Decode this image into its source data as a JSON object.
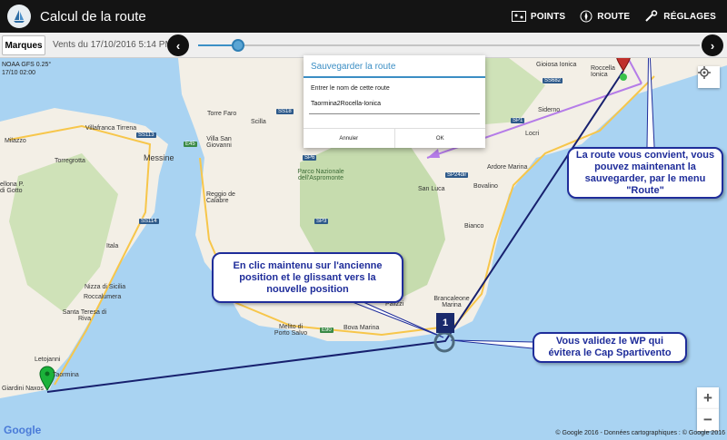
{
  "app": {
    "title": "Calcul de la route"
  },
  "toolbar": {
    "points_label": "POINTS",
    "route_label": "ROUTE",
    "settings_label": "RÉGLAGES"
  },
  "timebar": {
    "tab_label": "Marques",
    "time_label": "Vents du 17/10/2016 5:14 PM",
    "prev_label": "‹",
    "next_label": "›",
    "slider_position": 0.08
  },
  "map": {
    "overlay_line1": "NOAA GFS 0.25°",
    "overlay_line2": "17/10 02:00",
    "labels": [
      {
        "id": "milazzo",
        "text": "Milazzo"
      },
      {
        "id": "villafranca",
        "text": "Villafranca Tirrena"
      },
      {
        "id": "torregrotta",
        "text": "Torregrotta"
      },
      {
        "id": "messina",
        "text": "Messine"
      },
      {
        "id": "torre-faro",
        "text": "Torre Faro"
      },
      {
        "id": "scilla",
        "text": "Scilla"
      },
      {
        "id": "villa-san-giovanni",
        "text": "Villa San Giovanni"
      },
      {
        "id": "parco",
        "text": "Parco Nazionale dell'Aspromonte"
      },
      {
        "id": "reggio",
        "text": "Reggio de Calabre"
      },
      {
        "id": "barcellona",
        "text": "ellona P. di Gotto"
      },
      {
        "id": "gioiosa",
        "text": "Gioiosa Ionica"
      },
      {
        "id": "roccella",
        "text": "Roccella Ionica"
      },
      {
        "id": "siderno",
        "text": "Siderno"
      },
      {
        "id": "locri",
        "text": "Locri"
      },
      {
        "id": "ardore",
        "text": "Ardore Marina"
      },
      {
        "id": "san-luca",
        "text": "San Luca"
      },
      {
        "id": "bovalino",
        "text": "Bovalino"
      },
      {
        "id": "bianco",
        "text": "Bianco"
      },
      {
        "id": "itala",
        "text": "Itala"
      },
      {
        "id": "nizza",
        "text": "Nizza di Sicilia"
      },
      {
        "id": "roccalumera",
        "text": "Roccalumera"
      },
      {
        "id": "santa-teresa",
        "text": "Santa Teresa di Riva"
      },
      {
        "id": "letojanni",
        "text": "Letojanni"
      },
      {
        "id": "taormina",
        "text": "Taormina"
      },
      {
        "id": "giardini",
        "text": "Giardini Naxos"
      },
      {
        "id": "melito",
        "text": "Melito di Porto Salvo"
      },
      {
        "id": "bova",
        "text": "Bova Marina"
      },
      {
        "id": "palizzi",
        "text": "Palizzi"
      },
      {
        "id": "brancaleone",
        "text": "Brancaleone Marina"
      }
    ],
    "roads": [
      {
        "id": "ss113",
        "text": "SS113"
      },
      {
        "id": "e45",
        "text": "E45"
      },
      {
        "id": "ss18",
        "text": "SS18"
      },
      {
        "id": "sp6",
        "text": "SP6"
      },
      {
        "id": "sp3",
        "text": "SP3"
      },
      {
        "id": "ss114",
        "text": "SS114"
      },
      {
        "id": "e90",
        "text": "E90"
      },
      {
        "id": "sp1",
        "text": "SP1"
      },
      {
        "id": "ss682",
        "text": "SS682"
      },
      {
        "id": "sp24",
        "text": "SP24dir"
      }
    ]
  },
  "dialog": {
    "title": "Sauvegarder la route",
    "prompt": "Entrer le nom de cette route",
    "input_value": "Taormina2Rocella-Ionica",
    "cancel_label": "Annuler",
    "ok_label": "OK"
  },
  "callouts": {
    "save": "La route vous convient, vous pouvez maintenant la sauvegarder, par le menu \"Route\"",
    "drag": "En clic maintenu sur l'ancienne position et le glissant vers la nouvelle position",
    "validate": "Vous validez le WP qui évitera le Cap Spartivento"
  },
  "waypoint": {
    "number": "1"
  },
  "controls": {
    "zoom_in": "+",
    "zoom_out": "−"
  },
  "attribution": {
    "google": "Google",
    "copyright": "© Google 2016 - Données cartographiques : © Google 2016"
  },
  "colors": {
    "route": "#17206e",
    "callout_border": "#1f2d9a",
    "annotation_arrow": "#b57ce8",
    "dialog_accent": "#3b8ec4",
    "appbar": "#141414",
    "sea": "#a9d3f2",
    "land": "#f3efe6"
  }
}
